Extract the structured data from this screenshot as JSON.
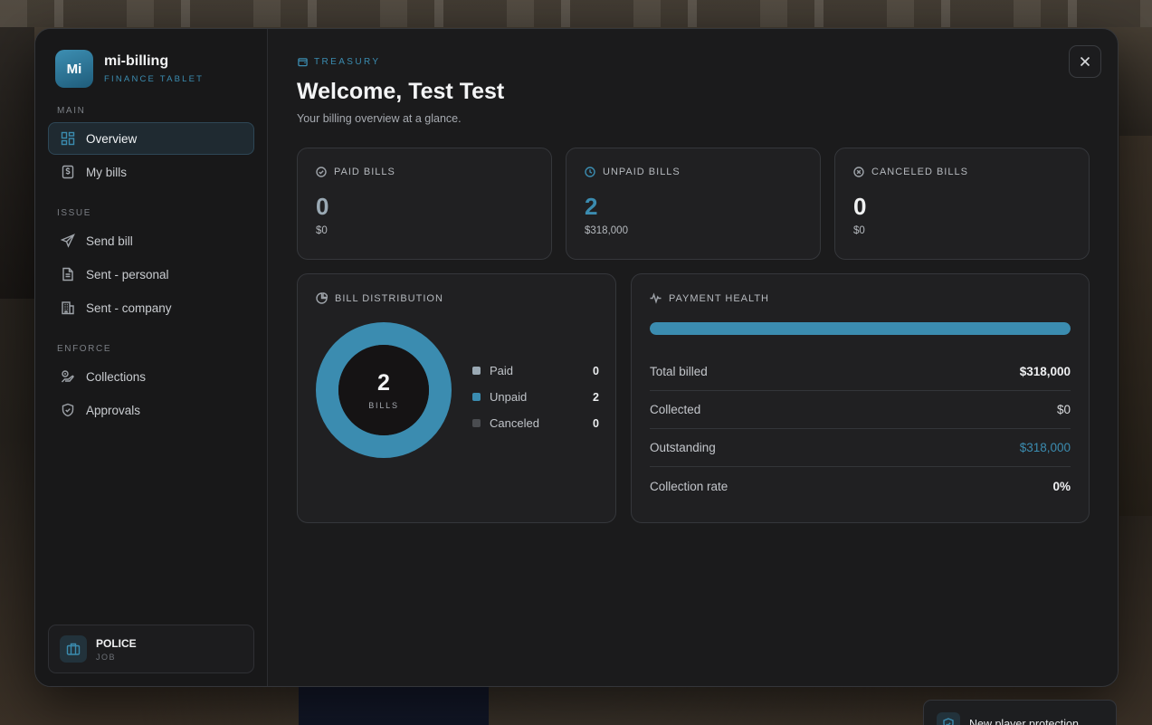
{
  "brand": {
    "logo_text": "Mi",
    "name": "mi-billing",
    "subtitle": "FINANCE TABLET"
  },
  "sidebar": {
    "sections": [
      {
        "label": "MAIN",
        "items": [
          {
            "label": "Overview",
            "icon": "grid-icon",
            "active": true
          },
          {
            "label": "My bills",
            "icon": "bill-icon"
          }
        ]
      },
      {
        "label": "ISSUE",
        "items": [
          {
            "label": "Send bill",
            "icon": "send-icon"
          },
          {
            "label": "Sent - personal",
            "icon": "document-icon"
          },
          {
            "label": "Sent - company",
            "icon": "building-icon"
          }
        ]
      },
      {
        "label": "ENFORCE",
        "items": [
          {
            "label": "Collections",
            "icon": "collections-icon"
          },
          {
            "label": "Approvals",
            "icon": "shield-icon"
          }
        ]
      }
    ],
    "job": {
      "title": "POLICE",
      "subtitle": "JOB",
      "icon": "briefcase-icon"
    }
  },
  "header": {
    "eyebrow": "TREASURY",
    "title": "Welcome, Test Test",
    "subtitle": "Your billing overview at a glance."
  },
  "stats": [
    {
      "label": "PAID BILLS",
      "value": "0",
      "amount": "$0",
      "icon": "check-circle-icon",
      "accent": false
    },
    {
      "label": "UNPAID BILLS",
      "value": "2",
      "amount": "$318,000",
      "icon": "clock-icon",
      "accent": true
    },
    {
      "label": "CANCELED BILLS",
      "value": "0",
      "amount": "$0",
      "icon": "x-circle-icon",
      "accent": false
    }
  ],
  "distribution": {
    "title": "BILL DISTRIBUTION",
    "center_value": "2",
    "center_label": "BILLS",
    "legend": [
      {
        "name": "Paid",
        "value": "0",
        "color": "#9aa9b4"
      },
      {
        "name": "Unpaid",
        "value": "2",
        "color": "#3b8cb0"
      },
      {
        "name": "Canceled",
        "value": "0",
        "color": "#4a4c50"
      }
    ]
  },
  "health": {
    "title": "PAYMENT HEALTH",
    "progress_fraction": 1.0,
    "rows": [
      {
        "label": "Total billed",
        "value": "$318,000",
        "style": "bold"
      },
      {
        "label": "Collected",
        "value": "$0",
        "style": "dim"
      },
      {
        "label": "Outstanding",
        "value": "$318,000",
        "style": "accent"
      },
      {
        "label": "Collection rate",
        "value": "0%",
        "style": "bold"
      }
    ]
  },
  "toast": {
    "text": "New player protection"
  },
  "colors": {
    "accent": "#3b8cb0",
    "panel": "#1b1b1c",
    "card": "#202022"
  }
}
